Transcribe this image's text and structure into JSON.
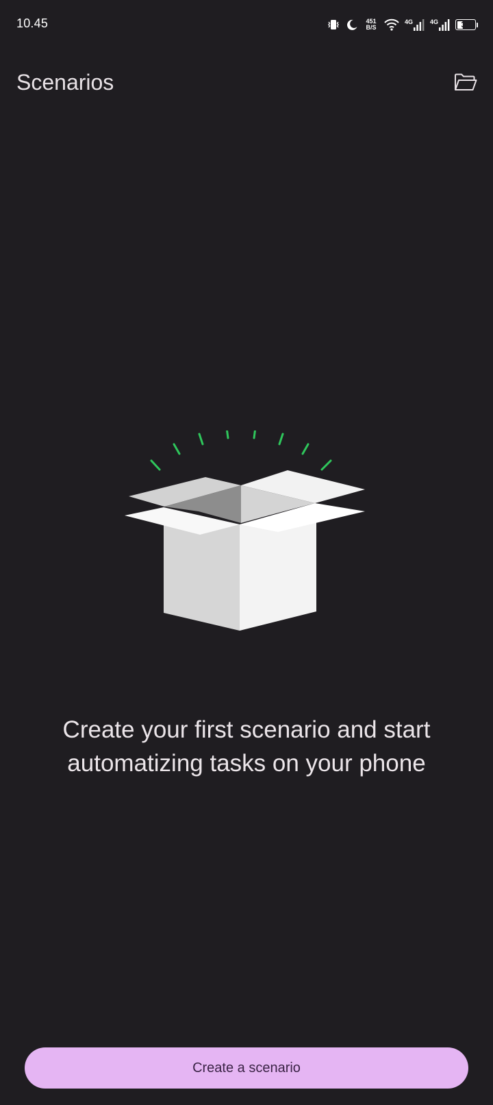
{
  "status_bar": {
    "time": "10.45",
    "net_speed_value": "451",
    "net_speed_unit": "B/S",
    "sim1_label": "4G",
    "sim2_label": "4G",
    "battery_percent": "34",
    "battery_level": 0.34,
    "icons": [
      "vibrate-icon",
      "moon-icon",
      "wifi-icon",
      "signal-icon",
      "signal-icon",
      "battery-icon"
    ]
  },
  "app_bar": {
    "title": "Scenarios",
    "action_icon": "folder-open-icon"
  },
  "empty_state": {
    "illustration": "open-box-illustration",
    "message": "Create your first scenario and start automatizing tasks on your phone"
  },
  "primary_action": {
    "label": "Create a scenario"
  },
  "colors": {
    "background": "#1f1d21",
    "on_surface": "#e8e2e6",
    "button_bg": "#e5b5f3",
    "button_text": "#3a2345",
    "accent_rays": "#2fc75c"
  }
}
